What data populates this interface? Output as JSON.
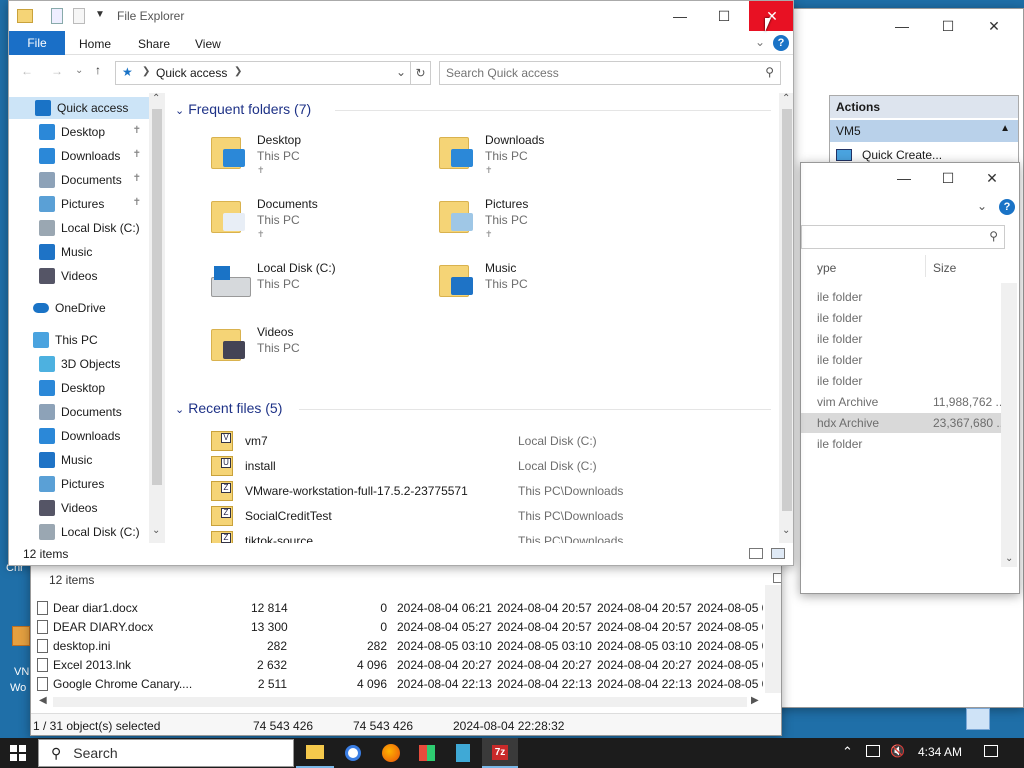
{
  "desktop": {
    "icon_labels": [
      "Chr",
      "VN",
      "Wo"
    ]
  },
  "background_window": {
    "actions_header": "Actions",
    "actions_item": "VM5",
    "quick_create": "Quick Create..."
  },
  "mid_window": {
    "columns": [
      "ype",
      "Size"
    ],
    "rows": [
      {
        "type": "ile folder",
        "size": ""
      },
      {
        "type": "ile folder",
        "size": ""
      },
      {
        "type": "ile folder",
        "size": ""
      },
      {
        "type": "ile folder",
        "size": ""
      },
      {
        "type": "ile folder",
        "size": ""
      },
      {
        "type": "vim Archive",
        "size": "11,988,762 ..."
      },
      {
        "type": "hdx Archive",
        "size": "23,367,680 ..."
      },
      {
        "type": "ile folder",
        "size": ""
      }
    ],
    "status": "12 items"
  },
  "file_manager": {
    "rows": [
      {
        "name": "Dear diar1.docx",
        "c1": "12 814",
        "c2": "0",
        "d1": "2024-08-04 06:21",
        "d2": "2024-08-04 20:57",
        "d3": "2024-08-04 20:57",
        "d4": "2024-08-05 0"
      },
      {
        "name": "DEAR DIARY.docx",
        "c1": "13 300",
        "c2": "0",
        "d1": "2024-08-04 05:27",
        "d2": "2024-08-04 20:57",
        "d3": "2024-08-04 20:57",
        "d4": "2024-08-05 0"
      },
      {
        "name": "desktop.ini",
        "c1": "282",
        "c2": "282",
        "d1": "2024-08-05 03:10",
        "d2": "2024-08-05 03:10",
        "d3": "2024-08-05 03:10",
        "d4": "2024-08-05 0"
      },
      {
        "name": "Excel 2013.lnk",
        "c1": "2 632",
        "c2": "4 096",
        "d1": "2024-08-04 20:27",
        "d2": "2024-08-04 20:27",
        "d3": "2024-08-04 20:27",
        "d4": "2024-08-05 0"
      },
      {
        "name": "Google Chrome Canary....",
        "c1": "2 511",
        "c2": "4 096",
        "d1": "2024-08-04 22:13",
        "d2": "2024-08-04 22:13",
        "d3": "2024-08-04 22:13",
        "d4": "2024-08-05 0"
      }
    ],
    "status": {
      "selected": "1 / 31 object(s) selected",
      "size1": "74 543 426",
      "size2": "74 543 426",
      "date": "2024-08-04 22:28:32"
    }
  },
  "explorer": {
    "title": "File Explorer",
    "ribbon_tabs": [
      "File",
      "Home",
      "Share",
      "View"
    ],
    "address": "Quick access",
    "search_placeholder": "Search Quick access",
    "nav": {
      "quick_access": "Quick access",
      "qa_items": [
        "Desktop",
        "Downloads",
        "Documents",
        "Pictures",
        "Local Disk (C:)",
        "Music",
        "Videos"
      ],
      "onedrive": "OneDrive",
      "this_pc": "This PC",
      "pc_items": [
        "3D Objects",
        "Desktop",
        "Documents",
        "Downloads",
        "Music",
        "Pictures",
        "Videos",
        "Local Disk (C:)"
      ]
    },
    "frequent_header": "Frequent folders (7)",
    "frequent": [
      {
        "name": "Desktop",
        "loc": "This PC"
      },
      {
        "name": "Downloads",
        "loc": "This PC"
      },
      {
        "name": "Documents",
        "loc": "This PC"
      },
      {
        "name": "Pictures",
        "loc": "This PC"
      },
      {
        "name": "Local Disk (C:)",
        "loc": "This PC"
      },
      {
        "name": "Music",
        "loc": "This PC"
      },
      {
        "name": "Videos",
        "loc": "This PC"
      }
    ],
    "recent_header": "Recent files (5)",
    "recent": [
      {
        "name": "vm7",
        "loc": "Local Disk (C:)",
        "badge": "V"
      },
      {
        "name": "install",
        "loc": "Local Disk (C:)",
        "badge": "U"
      },
      {
        "name": "VMware-workstation-full-17.5.2-23775571",
        "loc": "This PC\\Downloads",
        "badge": "Z"
      },
      {
        "name": "SocialCreditTest",
        "loc": "This PC\\Downloads",
        "badge": "Z"
      },
      {
        "name": "tiktok-source",
        "loc": "This PC\\Downloads",
        "badge": "Z"
      }
    ],
    "status": "12 items"
  },
  "taskbar": {
    "search": "Search",
    "time": "4:34 AM",
    "app_7z": "7z"
  },
  "colors": {
    "accent": "#0063b1",
    "close": "#e81123",
    "taskbar": "#1c1c1c"
  }
}
